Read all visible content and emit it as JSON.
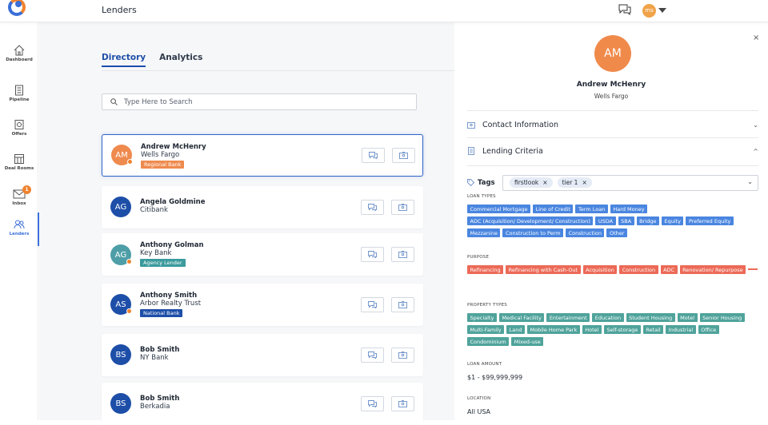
{
  "header": {
    "title": "Lenders",
    "user_initials": "ms"
  },
  "sidebar": {
    "items": [
      {
        "label": "Dashboard"
      },
      {
        "label": "Pipeline"
      },
      {
        "label": "Offers"
      },
      {
        "label": "Deal Rooms"
      },
      {
        "label": "Inbox",
        "badge": "1"
      },
      {
        "label": "Lenders",
        "active": true
      }
    ]
  },
  "main": {
    "tabs": [
      {
        "label": "Directory",
        "active": true
      },
      {
        "label": "Analytics"
      }
    ],
    "search": {
      "placeholder": "Type Here to Search"
    },
    "lenders": [
      {
        "initials": "AM",
        "name": "Andrew McHenry",
        "bank": "Wells Fargo",
        "tag": "Regional Bank",
        "tag_color": "#ef8a4e",
        "avatar_color": "#ef8a4e",
        "dot": true,
        "selected": true
      },
      {
        "initials": "AG",
        "name": "Angela Goldmine",
        "bank": "Citibank",
        "tag": "",
        "avatar_color": "#1d4ea8",
        "dot": false
      },
      {
        "initials": "AG",
        "name": "Anthony Golman",
        "bank": "Key Bank",
        "tag": "Agency Lender",
        "tag_color": "#3b9a9c",
        "avatar_color": "#4e9ea7",
        "dot": true
      },
      {
        "initials": "AS",
        "name": "Anthony Smith",
        "bank": "Arbor Realty Trust",
        "tag": "National Bank",
        "tag_color": "#1d4ea8",
        "avatar_color": "#1d4ea8",
        "dot": true
      },
      {
        "initials": "BS",
        "name": "Bob Smith",
        "bank": "NY Bank",
        "tag": "",
        "avatar_color": "#1d4ea8",
        "dot": false
      },
      {
        "initials": "BS",
        "name": "Bob Smith",
        "bank": "Berkadia",
        "tag": "",
        "avatar_color": "#1d4ea8",
        "dot": false
      }
    ]
  },
  "panel": {
    "initials": "AM",
    "name": "Andrew McHenry",
    "bank": "Wells Fargo",
    "close_label": "×",
    "contact_label": "Contact Information",
    "criteria_label": "Lending Criteria",
    "tags_label": "Tags",
    "tags": [
      "firstlook",
      "tier 1"
    ],
    "loan_types_label": "LOAN TYPES",
    "loan_types": [
      "Commercial Mortgage",
      "Line of Credit",
      "Term Loan",
      "Hard Money",
      "ADC (Acquisition/ Development/ Construction)",
      "USDA",
      "SBA",
      "Bridge",
      "Equity",
      "Preferred Equity",
      "Mezzanine",
      "Construction to Perm",
      "Construction",
      "Other"
    ],
    "purpose_label": "PURPOSE",
    "purpose": [
      "Refinancing",
      "Refinancing with Cash-Out",
      "Acquisition",
      "Construction",
      "ADC",
      "Renovation/ Repurpose"
    ],
    "property_types_label": "PROPERTY TYPES",
    "property_types": [
      "Specialty",
      "Medical Facility",
      "Entertainment",
      "Education",
      "Student Housing",
      "Motel",
      "Senior Housing",
      "Multi-Family",
      "Land",
      "Mobile Home Park",
      "Hotel",
      "Self-storage",
      "Retail",
      "Industrial",
      "Office",
      "Condominium",
      "Mixed-use"
    ],
    "loan_amount_label": "LOAN AMOUNT",
    "loan_amount": "$1 - $99,999,999",
    "location_label": "LOCATION",
    "location": "All USA"
  },
  "colors": {
    "primary": "#1e4ea8",
    "accent": "#f0832f",
    "blue_pill": "#4a86e0",
    "red_pill": "#ec6a57",
    "teal_pill": "#4fa39b"
  }
}
